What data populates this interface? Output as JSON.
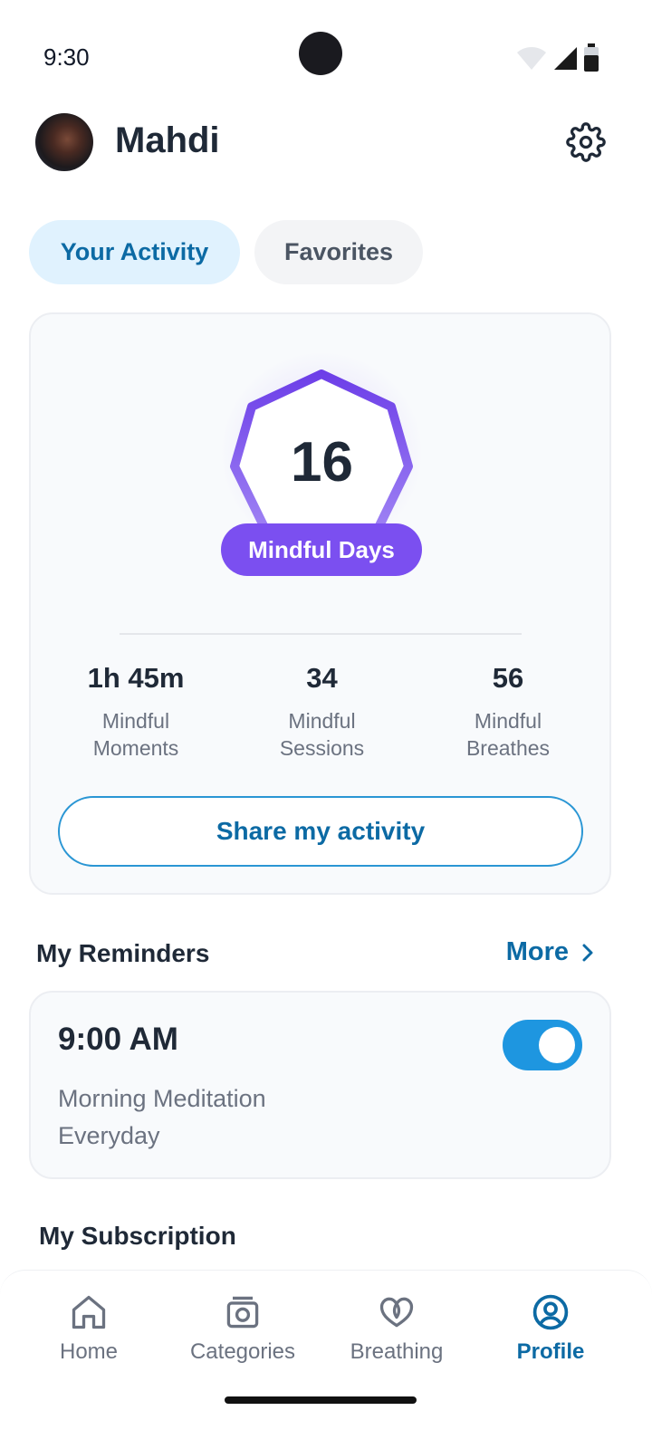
{
  "status_bar": {
    "time": "9:30",
    "icons": [
      "wifi-icon",
      "signal-icon",
      "battery-icon"
    ]
  },
  "header": {
    "user_name": "Mahdi",
    "avatar_icon": "avatar",
    "settings_icon": "gear-icon"
  },
  "tabs": [
    {
      "label": "Your Activity",
      "active": true
    },
    {
      "label": "Favorites",
      "active": false
    }
  ],
  "activity": {
    "mindful_days_count": "16",
    "mindful_days_label": "Mindful Days",
    "stats": [
      {
        "value": "1h 45m",
        "label_line1": "Mindful",
        "label_line2": "Moments"
      },
      {
        "value": "34",
        "label_line1": "Mindful",
        "label_line2": "Sessions"
      },
      {
        "value": "56",
        "label_line1": "Mindful",
        "label_line2": "Breathes"
      }
    ],
    "share_label": "Share my activity"
  },
  "reminders": {
    "title": "My Reminders",
    "more_label": "More",
    "items": [
      {
        "time": "9:00 AM",
        "title": "Morning Meditation",
        "repeat": "Everyday",
        "enabled": true
      }
    ]
  },
  "subscription": {
    "title": "My Subscription"
  },
  "bottom_nav": {
    "items": [
      {
        "label": "Home",
        "icon": "home-icon",
        "active": false
      },
      {
        "label": "Categories",
        "icon": "categories-icon",
        "active": false
      },
      {
        "label": "Breathing",
        "icon": "breathing-heart-icon",
        "active": false
      },
      {
        "label": "Profile",
        "icon": "profile-icon",
        "active": true
      }
    ]
  },
  "colors": {
    "accent_blue": "#0c6aa4",
    "toggle_blue": "#1e96e0",
    "badge_purple": "#7b4ff0",
    "tab_active_bg": "#e0f2fe"
  }
}
